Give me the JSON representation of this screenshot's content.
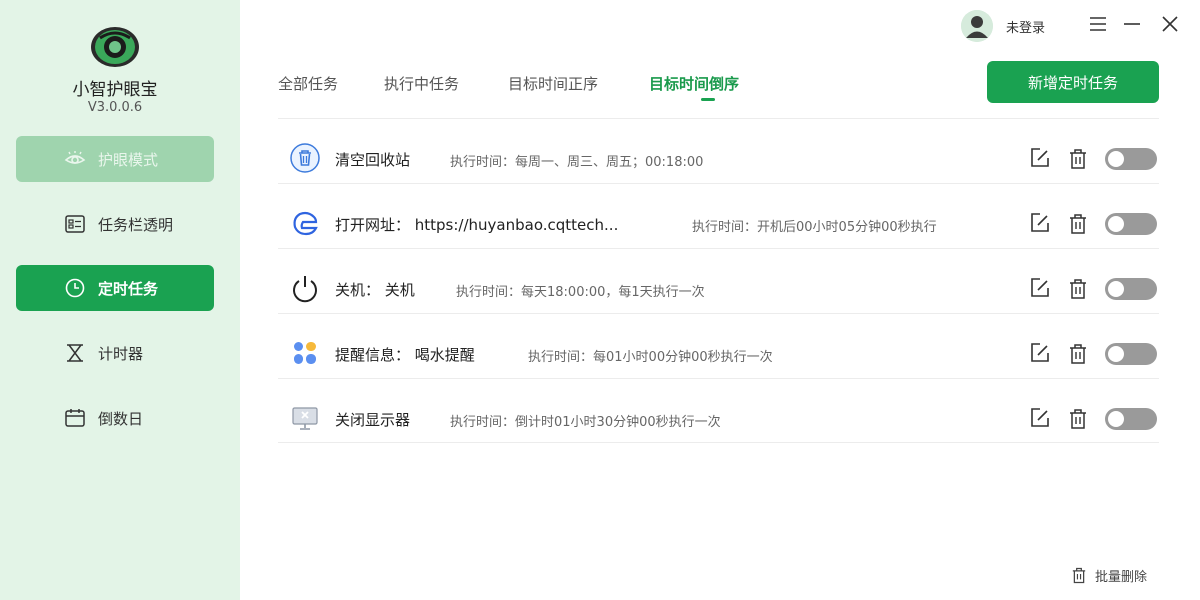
{
  "app": {
    "name": "小智护眼宝",
    "version": "V3.0.0.6"
  },
  "sidebar": {
    "items": [
      {
        "label": "护眼模式",
        "icon": "eye-icon",
        "state": "disabled"
      },
      {
        "label": "任务栏透明",
        "icon": "taskbar-icon",
        "state": "normal"
      },
      {
        "label": "定时任务",
        "icon": "clock-icon",
        "state": "active"
      },
      {
        "label": "计时器",
        "icon": "hourglass-icon",
        "state": "normal"
      },
      {
        "label": "倒数日",
        "icon": "calendar-icon",
        "state": "normal"
      }
    ]
  },
  "header": {
    "user_label": "未登录"
  },
  "tabs": [
    {
      "label": "全部任务"
    },
    {
      "label": "执行中任务"
    },
    {
      "label": "目标时间正序"
    },
    {
      "label": "目标时间倒序",
      "active": true
    }
  ],
  "add_button": {
    "label": "新增定时任务"
  },
  "tasks": [
    {
      "name": "清空回收站",
      "time": "执行时间：每周一、周三、周五；00:18:00",
      "icon": "recycle-bin-icon",
      "enabled": false
    },
    {
      "name": "打开网址： https://huyanbao.cqttech...",
      "time": "执行时间：开机后00小时05分钟00秒执行",
      "icon": "browser-icon",
      "enabled": false
    },
    {
      "name": "关机： 关机",
      "time": "执行时间：每天18:00:00，每1天执行一次",
      "icon": "power-icon",
      "enabled": false
    },
    {
      "name": "提醒信息： 喝水提醒",
      "time": "执行时间：每01小时00分钟00秒执行一次",
      "icon": "reminder-icon",
      "enabled": false
    },
    {
      "name": "关闭显示器",
      "time": "执行时间：倒计时01小时30分钟00秒执行一次",
      "icon": "monitor-off-icon",
      "enabled": false
    }
  ],
  "batch_delete": {
    "label": "批量删除"
  },
  "colors": {
    "accent": "#1aa251",
    "sidebar_bg": "#e3f4e7",
    "toggle_off": "#9a9a9a"
  }
}
